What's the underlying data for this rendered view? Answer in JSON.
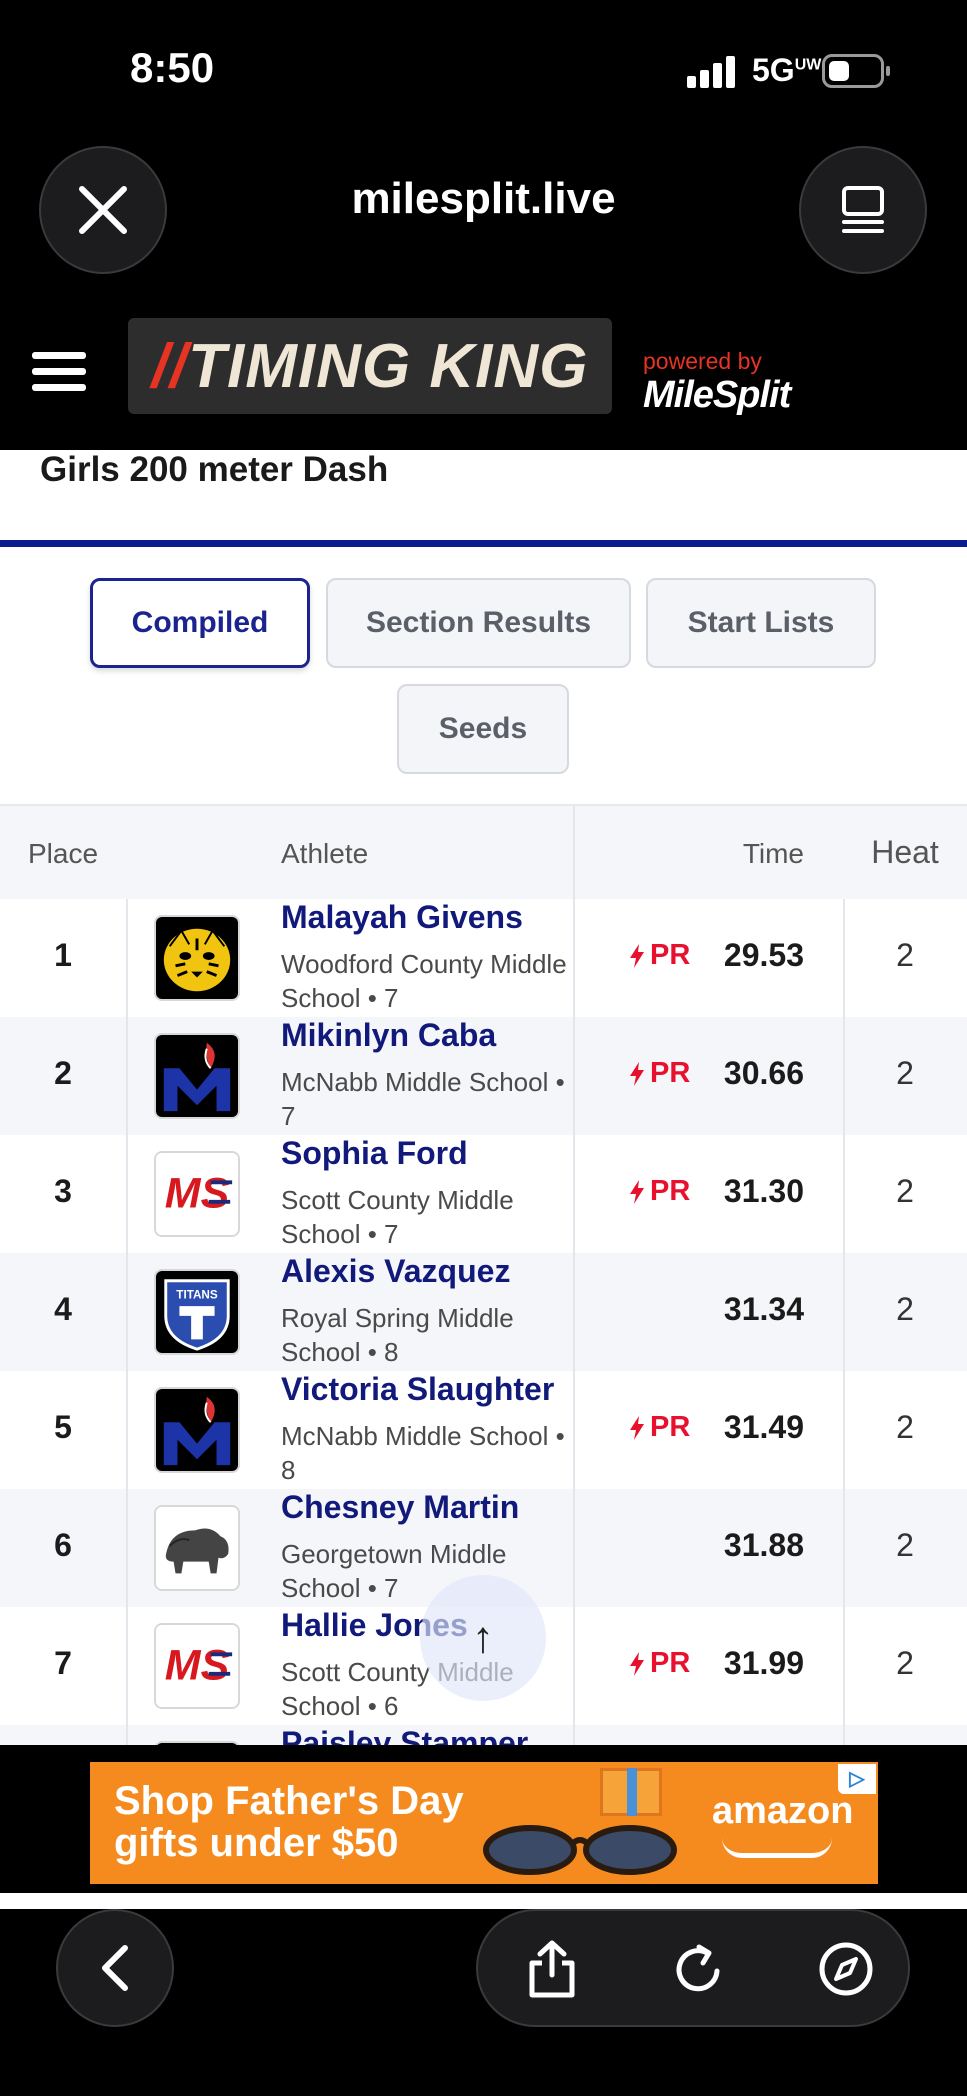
{
  "status_bar": {
    "time": "8:50",
    "network": "5G",
    "network_sup": "UW"
  },
  "browser": {
    "url": "milesplit.live"
  },
  "header": {
    "logo_slashes": "//",
    "logo_text": "TIMING KING",
    "powered_by": "powered by",
    "partner": "MileSplit"
  },
  "event": {
    "title": "Girls 200 meter Dash"
  },
  "tabs": [
    {
      "label": "Compiled",
      "active": true
    },
    {
      "label": "Section Results",
      "active": false
    },
    {
      "label": "Start Lists",
      "active": false
    },
    {
      "label": "Seeds",
      "active": false
    }
  ],
  "table": {
    "headers": {
      "place": "Place",
      "athlete": "Athlete",
      "time": "Time",
      "heat": "Heat"
    },
    "rows": [
      {
        "place": "1",
        "name": "Malayah Givens",
        "school": "Woodford County Middle School • 7",
        "pr": "PR",
        "time": "29.53",
        "heat": "2",
        "logo": "tiger-logo"
      },
      {
        "place": "2",
        "name": "Mikinlyn Caba",
        "school": "McNabb Middle School • 7",
        "pr": "PR",
        "time": "30.66",
        "heat": "2",
        "logo": "m-logo"
      },
      {
        "place": "3",
        "name": "Sophia Ford",
        "school": "Scott County Middle School • 7",
        "pr": "PR",
        "time": "31.30",
        "heat": "2",
        "logo": "ms-logo"
      },
      {
        "place": "4",
        "name": "Alexis Vazquez",
        "school": "Royal Spring Middle School • 8",
        "pr": "",
        "time": "31.34",
        "heat": "2",
        "logo": "titans-logo"
      },
      {
        "place": "5",
        "name": "Victoria Slaughter",
        "school": "McNabb Middle School • 8",
        "pr": "PR",
        "time": "31.49",
        "heat": "2",
        "logo": "m-logo"
      },
      {
        "place": "6",
        "name": "Chesney Martin",
        "school": "Georgetown Middle School • 7",
        "pr": "",
        "time": "31.88",
        "heat": "2",
        "logo": "bison-logo"
      },
      {
        "place": "7",
        "name": "Hallie Jones",
        "school": "Scott County Middle School • 6",
        "pr": "PR",
        "time": "31.99",
        "heat": "2",
        "logo": "ms-logo"
      },
      {
        "place": "",
        "name": "Paisley Stamper",
        "school": "",
        "pr": "",
        "time": "",
        "heat": "",
        "logo": "m-logo"
      }
    ]
  },
  "scroll_top": "↑",
  "ad": {
    "line1": "Shop Father's Day",
    "line2": "gifts under $50",
    "brand": "amazon",
    "choices": "▷"
  },
  "colors": {
    "accent": "#1a238e",
    "pr_red": "#e8112d",
    "brand_red": "#e63323",
    "ad_orange": "#f58b1f"
  }
}
